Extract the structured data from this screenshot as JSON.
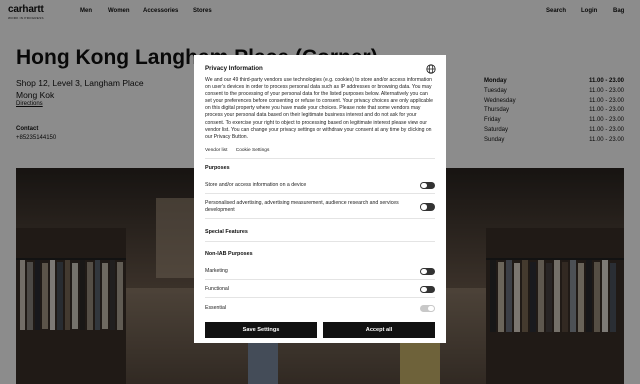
{
  "header": {
    "logo": "carhartt",
    "logo_sub": "WORK IN PROGRESS",
    "nav_left": [
      "Men",
      "Women",
      "Accessories",
      "Stores"
    ],
    "nav_right": [
      "Search",
      "Login",
      "Bag"
    ]
  },
  "store": {
    "title": "Hong Kong Langham Place (Corner)",
    "address_line1": "Shop 12, Level 3, Langham Place",
    "address_line2": "Mong Kok",
    "directions": "Directions",
    "contact_heading": "Contact",
    "phone": "+85235144150",
    "hours": [
      {
        "day": "Monday",
        "time": "11.00 - 23.00"
      },
      {
        "day": "Tuesday",
        "time": "11.00 - 23.00"
      },
      {
        "day": "Wednesday",
        "time": "11.00 - 23.00"
      },
      {
        "day": "Thursday",
        "time": "11.00 - 23.00"
      },
      {
        "day": "Friday",
        "time": "11.00 - 23.00"
      },
      {
        "day": "Saturday",
        "time": "11.00 - 23.00"
      },
      {
        "day": "Sunday",
        "time": "11.00 - 23.00"
      }
    ]
  },
  "consent": {
    "title": "Privacy Information",
    "body": "We and our 49 third-party vendors use technologies (e.g. cookies) to store and/or access information on user's devices in order to process personal data such as IP addresses or browsing data. You may consent to the processing of your personal data for the listed purposes below. Alternatively you can set your preferences before consenting or refuse to consent. Your privacy choices are only applicable on this digital property where you have made your choices. Please note that some vendors may process your personal data based on their legitimate business interest and do not ask for your consent. To exercise your right to object to processing based on legitimate interest please view our vendor list. You can change your privacy settings or withdraw your consent at any time by clicking on our Privacy Button.",
    "link_vendor": "Vendor list",
    "link_cookie": "Cookie Settings",
    "purposes_heading": "Purposes",
    "purposes": [
      "Store and/or access information on a device",
      "Personalised advertising, advertising measurement, audience research and services development"
    ],
    "special_heading": "Special Features",
    "noniab_heading": "Non-IAB Purposes",
    "noniab": [
      "Marketing",
      "Functional",
      "Essential"
    ],
    "btn_save": "Save Settings",
    "btn_accept": "Accept all"
  }
}
